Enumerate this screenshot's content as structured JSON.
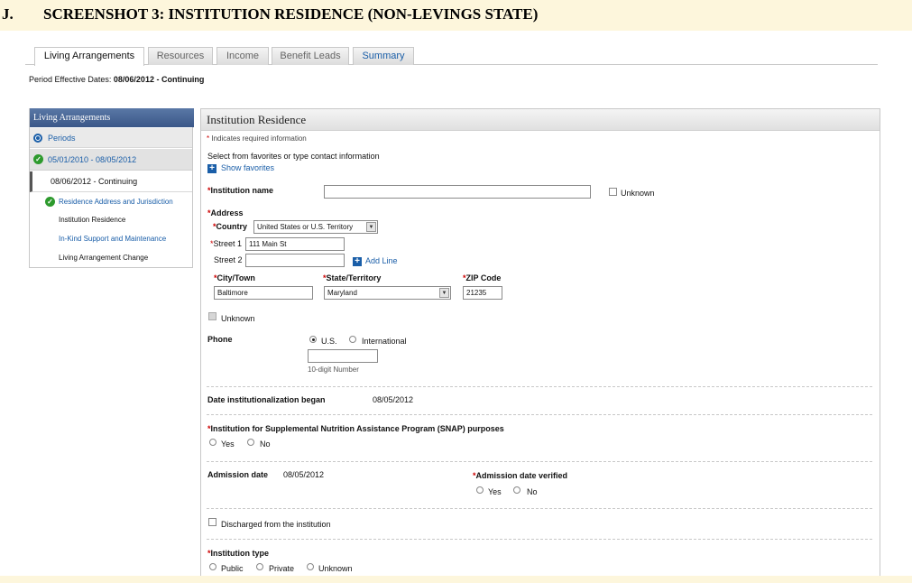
{
  "heading": {
    "number": "J.",
    "title": "SCREENSHOT 3:  INSTITUTION RESIDENCE (NON-LEVINGS STATE)"
  },
  "tabs": [
    {
      "label": "Living Arrangements",
      "active": true
    },
    {
      "label": "Resources",
      "active": false
    },
    {
      "label": "Income",
      "active": false
    },
    {
      "label": "Benefit Leads",
      "active": false
    },
    {
      "label": "Summary",
      "active": false
    }
  ],
  "period": {
    "label": "Period Effective Dates:",
    "value": "08/06/2012 - Continuing"
  },
  "sidebar": {
    "title": "Living Arrangements",
    "periods": "Periods",
    "range": "05/01/2010 - 08/05/2012",
    "continuing": "08/06/2012 - Continuing",
    "items": [
      {
        "label": "Residence Address and Jurisdiction",
        "complete": true
      },
      {
        "label": "Institution Residence",
        "complete": false
      },
      {
        "label": "In-Kind Support and Maintenance",
        "complete": false
      },
      {
        "label": "Living Arrangement Change",
        "complete": false
      }
    ]
  },
  "form": {
    "title": "Institution Residence",
    "required_marker": "*",
    "required_note": "Indicates required information",
    "favorites_instruction": "Select from favorites or type contact information",
    "show_favorites": "Show favorites",
    "institution_name_label": "Institution name",
    "institution_name_value": "",
    "unknown": "Unknown",
    "address_label": "Address",
    "country_label": "Country",
    "country_value": "United States or U.S. Territory",
    "street1_label": "Street 1",
    "street1_value": "111 Main St",
    "street2_label": "Street 2",
    "street2_value": "",
    "add_line": "Add Line",
    "city_label": "City/Town",
    "city_value": "Baltimore",
    "state_label": "State/Territory",
    "state_value": "Maryland",
    "zip_label": "ZIP Code",
    "zip_value": "21235",
    "phone_label": "Phone",
    "phone_us": "U.S.",
    "phone_international": "International",
    "phone_value": "",
    "phone_hint": "10-digit Number",
    "date_began_label": "Date institutionalization began",
    "date_began_value": "08/05/2012",
    "snap_label": "Institution for Supplemental Nutrition Assistance Program (SNAP) purposes",
    "yes": "Yes",
    "no": "No",
    "admission_date_label": "Admission date",
    "admission_date_value": "08/05/2012",
    "admission_verified_label": "Admission date verified",
    "discharged_label": "Discharged from the institution",
    "institution_type_label": "Institution type",
    "type_public": "Public",
    "type_private": "Private",
    "type_unknown": "Unknown"
  },
  "colors": {
    "accent": "#1a5ea8",
    "page_background": "#fdf6dc",
    "sidebar_header": "#3a5788",
    "required": "#cc0000",
    "complete": "#2d9a2d"
  }
}
